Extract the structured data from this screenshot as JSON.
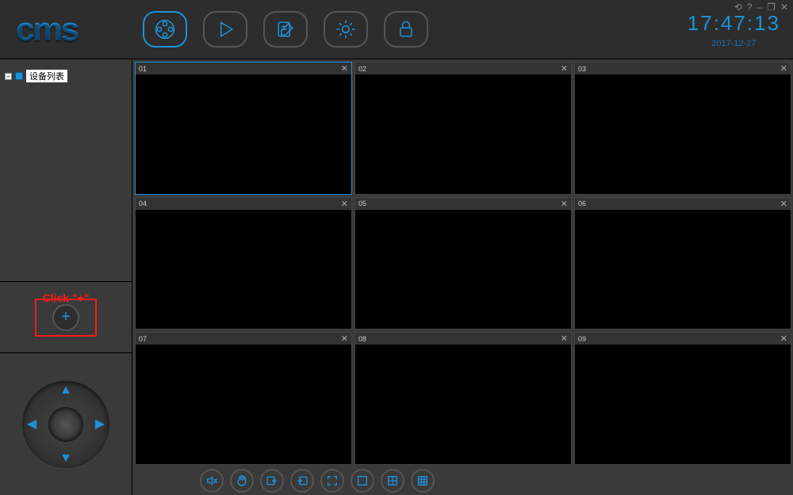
{
  "app": {
    "logo_text": "cms"
  },
  "window_controls": {
    "refresh": "⟲",
    "help": "?",
    "minimize": "–",
    "restore": "❐",
    "close": "✕"
  },
  "header_buttons": [
    {
      "name": "record",
      "active": true
    },
    {
      "name": "playback",
      "active": false
    },
    {
      "name": "log",
      "active": false
    },
    {
      "name": "settings",
      "active": false
    },
    {
      "name": "lock",
      "active": false
    }
  ],
  "clock": {
    "time": "17:47:13",
    "date": "2017-12-27"
  },
  "tree": {
    "root_label": "设备列表"
  },
  "add_hint": "Click \"+\"",
  "cells": [
    {
      "num": "01",
      "selected": true
    },
    {
      "num": "02",
      "selected": false
    },
    {
      "num": "03",
      "selected": false
    },
    {
      "num": "04",
      "selected": false
    },
    {
      "num": "05",
      "selected": false
    },
    {
      "num": "06",
      "selected": false
    },
    {
      "num": "07",
      "selected": false
    },
    {
      "num": "08",
      "selected": false
    },
    {
      "num": "09",
      "selected": false
    }
  ],
  "bottom_tools": [
    "mute",
    "hand",
    "snapshot-in",
    "snapshot-out",
    "fullscreen",
    "layout-1",
    "layout-4",
    "layout-9"
  ]
}
